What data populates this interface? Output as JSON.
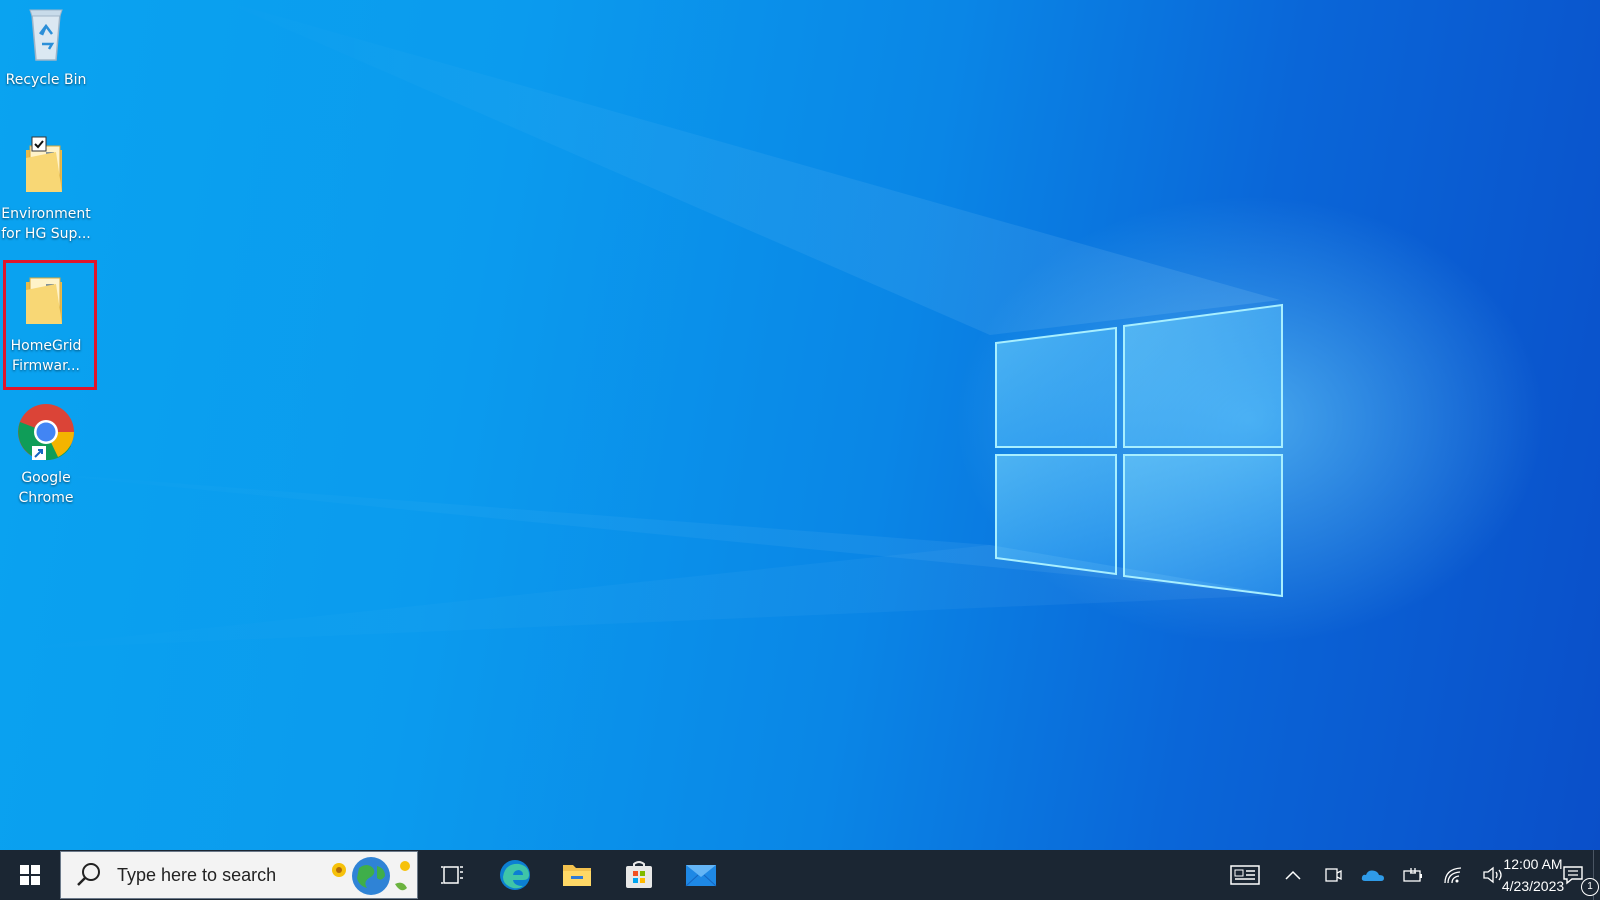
{
  "desktop": {
    "icons": [
      {
        "label": "Recycle Bin",
        "icon": "recycle-bin-icon"
      },
      {
        "label": "Environment for HG Sup...",
        "icon": "folder-icon",
        "checked": true
      },
      {
        "label": "HomeGrid Firmwar...",
        "icon": "folder-icon",
        "highlighted": true
      },
      {
        "label": "Google Chrome",
        "icon": "chrome-icon",
        "shortcut": true
      }
    ],
    "highlight_color": "#e0152a"
  },
  "taskbar": {
    "search": {
      "placeholder": "Type here to search"
    },
    "apps": [
      "task-view-icon",
      "edge-icon",
      "file-explorer-icon",
      "store-icon",
      "mail-icon"
    ],
    "tray": [
      "news-icon",
      "chevron-up-icon",
      "meet-icon",
      "onedrive-icon",
      "battery-icon",
      "wifi-icon",
      "volume-icon"
    ],
    "clock": {
      "time": "12:00 AM",
      "date": "4/23/2023"
    },
    "notifications": {
      "count": "1"
    }
  }
}
